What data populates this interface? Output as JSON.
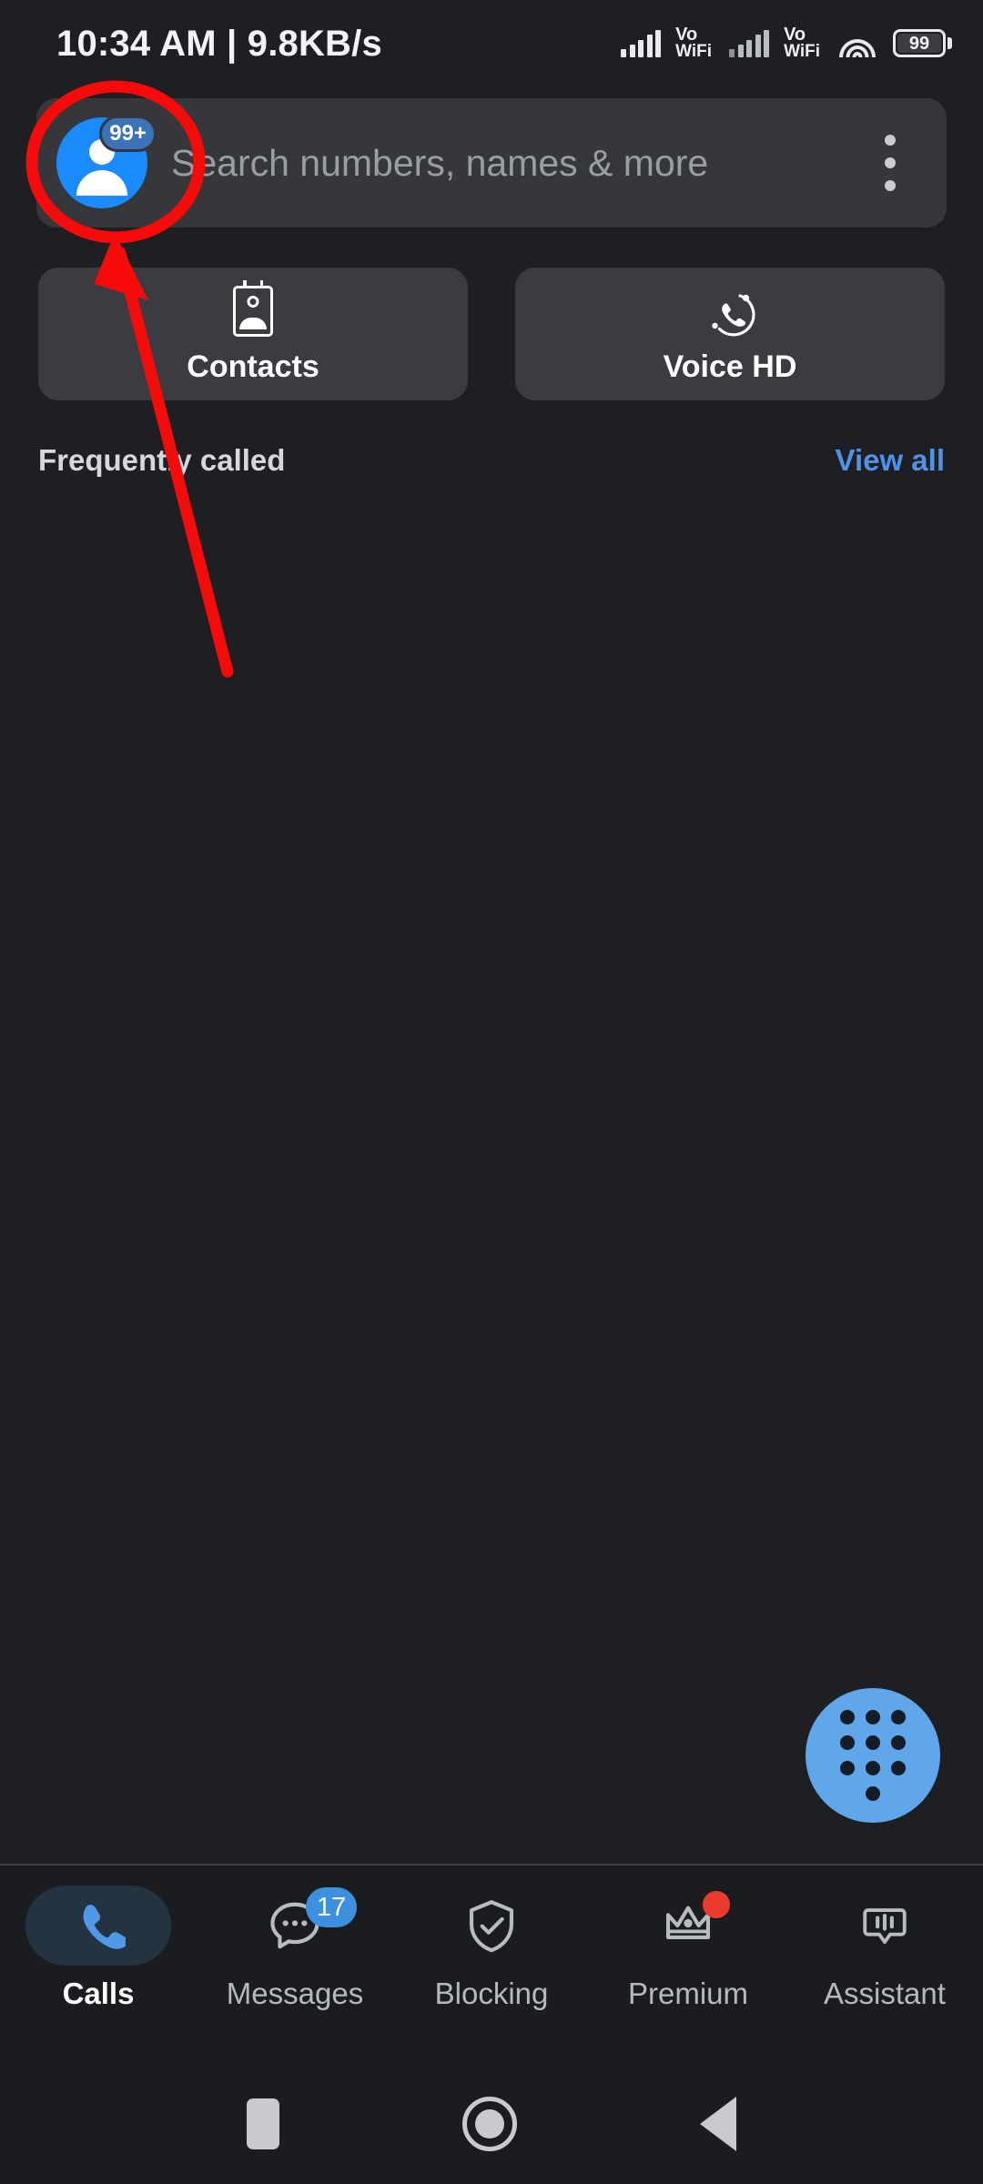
{
  "status_bar": {
    "time": "10:34 AM | 9.8KB/s",
    "sim1_label_line1": "Vo",
    "sim1_label_line2": "WiFi",
    "sim2_label_line1": "Vo",
    "sim2_label_line2": "WiFi",
    "battery_level": "99"
  },
  "search": {
    "placeholder": "Search numbers, names & more",
    "avatar_badge": "99+"
  },
  "quick_actions": [
    {
      "label": "Contacts",
      "icon": "contact-card-icon"
    },
    {
      "label": "Voice HD",
      "icon": "voice-hd-icon"
    }
  ],
  "frequently_called": {
    "title": "Frequently called",
    "view_all": "View all"
  },
  "fab": {
    "icon": "dialpad-icon"
  },
  "bottom_nav": {
    "items": [
      {
        "label": "Calls",
        "icon": "phone-icon",
        "active": true,
        "badge": ""
      },
      {
        "label": "Messages",
        "icon": "chat-bubble-icon",
        "active": false,
        "badge": "17"
      },
      {
        "label": "Blocking",
        "icon": "shield-check-icon",
        "active": false,
        "badge": ""
      },
      {
        "label": "Premium",
        "icon": "crown-icon",
        "active": false,
        "badge": "dot"
      },
      {
        "label": "Assistant",
        "icon": "assistant-icon",
        "active": false,
        "badge": ""
      }
    ]
  },
  "android_nav": {
    "recents": "recents-icon",
    "home": "home-icon",
    "back": "back-icon"
  },
  "annotation": {
    "color": "#f60a0a",
    "shape": "circle-with-arrow"
  },
  "colors": {
    "background": "#1d1f23",
    "card": "#3a3c41",
    "search_bar": "#35373b",
    "accent_blue": "#4f92e8",
    "avatar_blue": "#1a8cff",
    "fab_blue": "#5fa6ea",
    "badge_blue": "#3d8fe0",
    "red_dot": "#eb3b2e",
    "annotation_red": "#f60a0a",
    "nav_bar": "#1a1c1f"
  }
}
